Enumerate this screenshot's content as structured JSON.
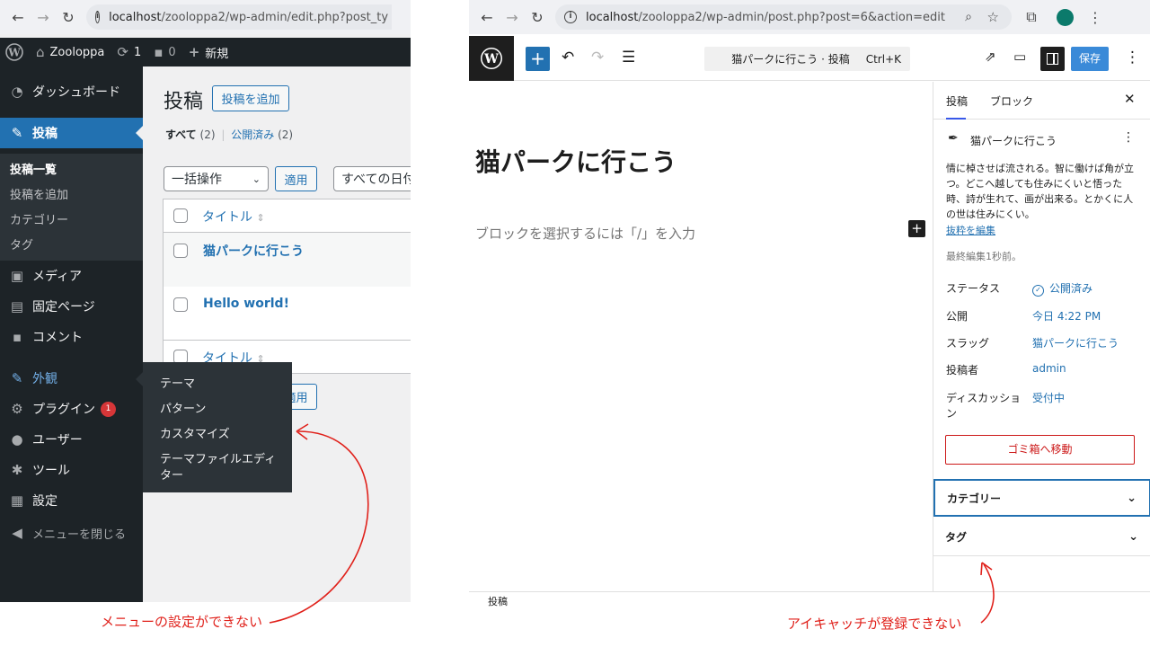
{
  "left_browser": {
    "url_host": "localhost",
    "url_path": "/zooloppa2/wp-admin/edit.php?post_ty"
  },
  "admin_bar": {
    "site_name": "Zooloppa",
    "updates_count": "1",
    "comments_count": "0",
    "new_label": "新規"
  },
  "sidebar": {
    "dashboard": "ダッシュボード",
    "posts": "投稿",
    "posts_sub": [
      "投稿一覧",
      "投稿を追加",
      "カテゴリー",
      "タグ"
    ],
    "media": "メディア",
    "pages": "固定ページ",
    "comments": "コメント",
    "appearance": "外観",
    "plugins": "プラグイン",
    "plugins_badge": "1",
    "users": "ユーザー",
    "tools": "ツール",
    "settings": "設定",
    "collapse": "メニューを閉じる"
  },
  "flyout": {
    "items": [
      "テーマ",
      "パターン",
      "カスタマイズ",
      "テーマファイルエディ",
      "ター"
    ]
  },
  "posts_list": {
    "title": "投稿",
    "add_new": "投稿を追加",
    "filter_all": "すべて",
    "filter_all_count": "(2)",
    "separator": "|",
    "filter_published": "公開済み",
    "filter_published_count": "(2)",
    "bulk_action": "一括操作",
    "apply": "適用",
    "dates_filter": "すべての日付",
    "column_title": "タイトル",
    "rows": [
      "猫パークに行こう",
      "Hello world!"
    ],
    "apply_bottom": "適用"
  },
  "right_browser": {
    "url_host": "localhost",
    "url_path": "/zooloppa2/wp-admin/post.php?post=6&action=edit"
  },
  "editor": {
    "command_label": "猫パークに行こう · 投稿",
    "command_shortcut": "Ctrl+K",
    "save": "保存",
    "post_title": "猫パークに行こう",
    "block_placeholder": "ブロックを選択するには「/」を入力",
    "footer_breadcrumb": "投稿"
  },
  "settings_panel": {
    "tab_post": "投稿",
    "tab_block": "ブロック",
    "post_name": "猫パークに行こう",
    "excerpt": "情に棹させば流される。智に働けば角が立つ。どこへ越しても住みにくいと悟った時、詩が生れて、画が出来る。とかくに人の世は住みにくい。",
    "edit_excerpt": "抜粋を編集",
    "last_edited": "最終編集1秒前。",
    "status_label": "ステータス",
    "status_value": "公開済み",
    "publish_label": "公開",
    "publish_value": "今日 4:22 PM",
    "slug_label": "スラッグ",
    "slug_value": "猫パークに行こう",
    "author_label": "投稿者",
    "author_value": "admin",
    "discussion_label_1": "ディスカッショ",
    "discussion_label_2": "ン",
    "discussion_value": "受付中",
    "trash": "ゴミ箱へ移動",
    "categories": "カテゴリー",
    "tags": "タグ"
  },
  "annotations": {
    "left": "メニューの設定ができない",
    "right": "アイキャッチが登録できない"
  },
  "colors": {
    "admin_dark": "#1d2327",
    "wp_blue": "#2271b1",
    "annotation_red": "#e0211b"
  }
}
